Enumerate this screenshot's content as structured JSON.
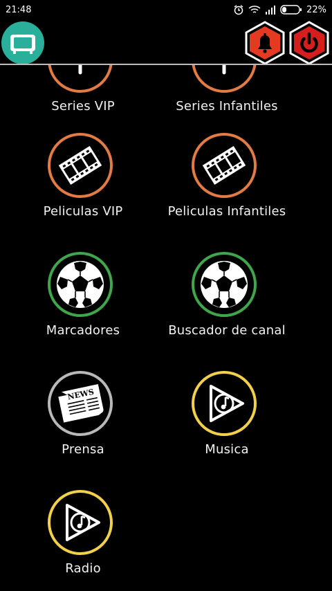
{
  "status_bar": {
    "time": "21:48",
    "battery": "22%"
  },
  "colors": {
    "tv_button": "#2ab09a",
    "hex_button_bg": "#e53a22",
    "ring_orange": "#e37b45",
    "ring_green": "#3fa64b",
    "ring_grey": "#b9b9b9",
    "ring_yellow": "#f1d14b"
  },
  "appbar": {
    "tv_icon": "tv-icon",
    "bell_icon": "bell-icon",
    "power_icon": "power-icon"
  },
  "menu": [
    {
      "label": "Series VIP",
      "icon": "series-icon",
      "ring": "orange"
    },
    {
      "label": "Series Infantiles",
      "icon": "series-icon",
      "ring": "orange"
    },
    {
      "label": "Peliculas VIP",
      "icon": "film-strip-icon",
      "ring": "orange"
    },
    {
      "label": "Peliculas Infantiles",
      "icon": "film-strip-icon",
      "ring": "orange"
    },
    {
      "label": "Marcadores",
      "icon": "soccer-ball-icon",
      "ring": "green"
    },
    {
      "label": "Buscador de canal",
      "icon": "soccer-ball-icon",
      "ring": "green"
    },
    {
      "label": "Prensa",
      "icon": "newspaper-icon",
      "ring": "grey",
      "icon_text": "NEWS"
    },
    {
      "label": "Musica",
      "icon": "music-play-icon",
      "ring": "yellow"
    },
    {
      "label": "Radio",
      "icon": "music-play-icon",
      "ring": "yellow"
    }
  ]
}
